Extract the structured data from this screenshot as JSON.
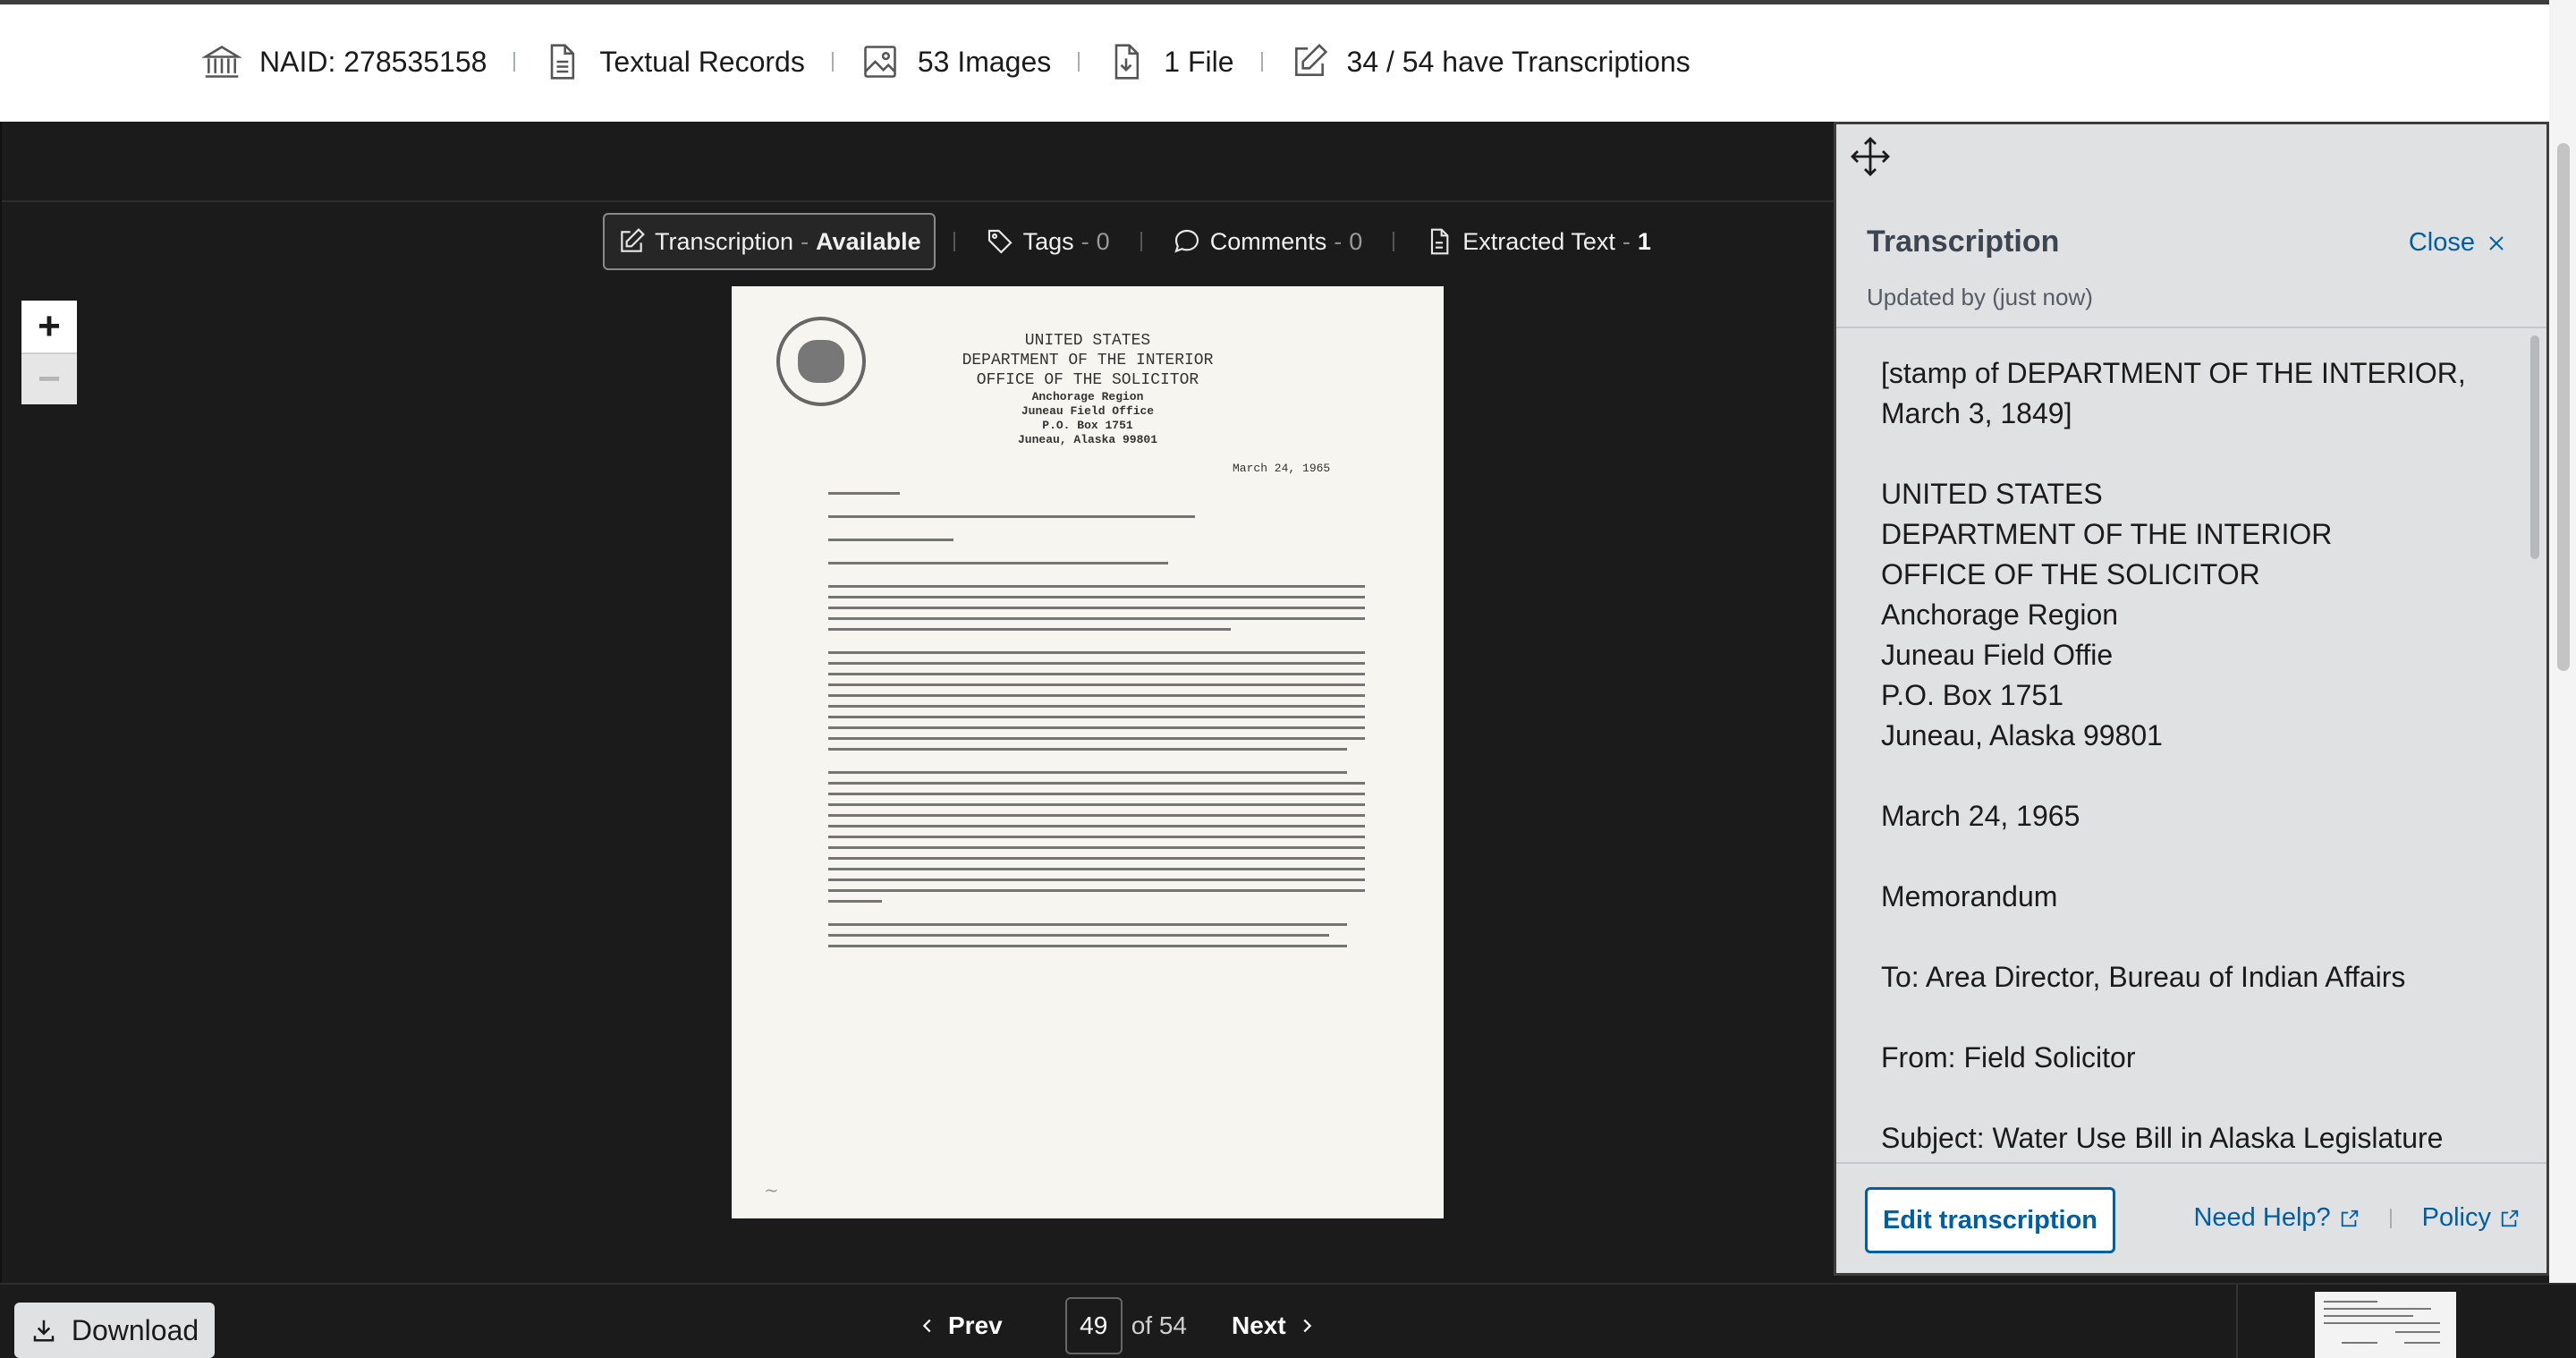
{
  "meta": {
    "naid": "NAID: 278535158",
    "record_type": "Textual Records",
    "images": "53 Images",
    "files": "1 File",
    "transcriptions": "34 / 54 have Transcriptions"
  },
  "tabs": {
    "transcription": {
      "label": "Transcription",
      "status": "Available"
    },
    "tags": {
      "label": "Tags",
      "count": "0"
    },
    "comments": {
      "label": "Comments",
      "count": "0"
    },
    "extracted": {
      "label": "Extracted Text",
      "count": "1"
    }
  },
  "zoom": {
    "in": "+",
    "out": "−"
  },
  "document": {
    "head": [
      "UNITED STATES",
      "DEPARTMENT OF THE INTERIOR",
      "OFFICE OF THE SOLICITOR"
    ],
    "head_small": [
      "Anchorage Region",
      "Juneau Field Office",
      "P.O. Box 1751",
      "Juneau, Alaska 99801"
    ],
    "date": "March 24, 1965"
  },
  "panel": {
    "title": "Transcription",
    "close_label": "Close",
    "updated": "Updated by (just now)",
    "paragraphs": [
      "[stamp of DEPARTMENT OF THE INTERIOR,\nMarch 3, 1849]",
      "UNITED STATES\nDEPARTMENT OF THE INTERIOR\nOFFICE OF THE SOLICITOR\nAnchorage Region\nJuneau Field Offie\nP.O. Box 1751\nJuneau, Alaska 99801",
      "March 24, 1965",
      "Memorandum",
      "To: Area Director, Bureau of Indian Affairs",
      "From: Field Solicitor",
      "Subject: Water Use Bill in Alaska Legislature"
    ],
    "edit_label": "Edit transcription",
    "help_label": "Need Help?",
    "policy_label": "Policy"
  },
  "bottom": {
    "download_label": "Download",
    "prev_label": "Prev",
    "next_label": "Next",
    "page_value": "49",
    "page_of": "of 54"
  },
  "colors": {
    "link": "#005ea2",
    "viewer_bg": "#1b1b1b",
    "panel_bg": "#dfe1e2"
  }
}
